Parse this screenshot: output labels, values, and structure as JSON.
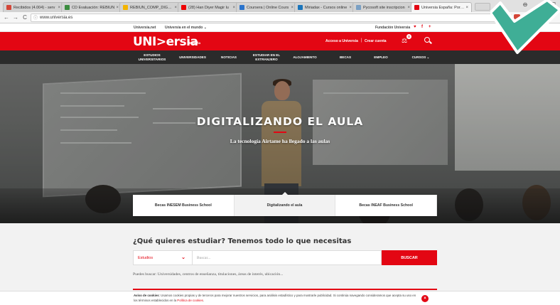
{
  "browser": {
    "tabs": [
      {
        "label": "Recibidos (4.004) - serv",
        "color": "#d44638"
      },
      {
        "label": "CD Evaluación: REBIUN",
        "color": "#3c8d40"
      },
      {
        "label": "REBIUN_COMP_DIG_1.2",
        "color": "#f4b400"
      },
      {
        "label": "(28) Han Diyer Magir lu",
        "color": "#e00"
      },
      {
        "label": "Coursera | Online Cours",
        "color": "#2a73cc"
      },
      {
        "label": "Miriadax - Cursos online",
        "color": "#1b75bb"
      },
      {
        "label": "Pycosoft site inscripcion",
        "color": "#7aa0c4"
      },
      {
        "label": "Universia España: Portal",
        "color": "#e30613"
      }
    ],
    "tab_close": "×",
    "window_controls": {
      "profile": "⊖",
      "minimize": "–",
      "maximize": "☐"
    },
    "nav": {
      "back": "←",
      "forward": "→",
      "reload": "C",
      "info": "ⓘ"
    },
    "url": "www.universia.es",
    "extensions": [
      "#e8a02c",
      "#d44638",
      "#555555",
      "#aaaaaa"
    ]
  },
  "site": {
    "top_links": {
      "net": "Universia.net",
      "world": "Universia en el mundo ⌄",
      "foundation": "Fundación Universia",
      "social": [
        "♥",
        "f",
        "+"
      ]
    },
    "logo": "UNI>ersia",
    "logo_country": "España",
    "account": {
      "access": "Acceso a Universia",
      "separator": "|",
      "create": "Crear cuenta"
    },
    "compare_icon": "⚖",
    "compare_count": "0",
    "brand_red": "#e30613",
    "nav": [
      {
        "label": "ESTUDIOS\nUNIVERSITARIOS"
      },
      {
        "label": "UNIVERSIDADES"
      },
      {
        "label": "NOTICIAS"
      },
      {
        "label": "ESTUDIAR EN EL\nEXTRANJERO"
      },
      {
        "label": "ALOJAMIENTO"
      },
      {
        "label": "BECAS"
      },
      {
        "label": "EMPLEO"
      },
      {
        "label": "CURSOS ⌄"
      }
    ],
    "hero": {
      "title": "DIGITALIZANDO EL AULA",
      "subtitle": "La tecnología Airtame ha llegado a las aulas"
    },
    "slider_tabs": [
      {
        "label": "Becas INESEM Business School",
        "active": false
      },
      {
        "label": "Digitalizando el aula",
        "active": true
      },
      {
        "label": "Becas INEAF Business School",
        "active": false
      }
    ],
    "study": {
      "title": "¿Qué quieres estudiar? Tenemos todo lo que necesitas",
      "select_value": "Estudios",
      "select_chevron": "⌄",
      "search_placeholder": "Buscar...",
      "button": "BUSCAR",
      "hint": "Puedes buscar: Universidades, centros de enseñanza, titulaciones, áreas de interés, ubicación..."
    },
    "cookie": {
      "bold": "Aviso de cookies",
      "text": ": Usamos cookies propias y de terceros para mejorar nuestros servicios, para análisis estadístico y para mostrarle publicidad. Si continúa navegando consideramos que acepta su uso en los términos establecidos en la ",
      "link": "Política de cookies",
      "end": ".",
      "close": "×"
    }
  },
  "overlay_check_color": "#3fae96"
}
